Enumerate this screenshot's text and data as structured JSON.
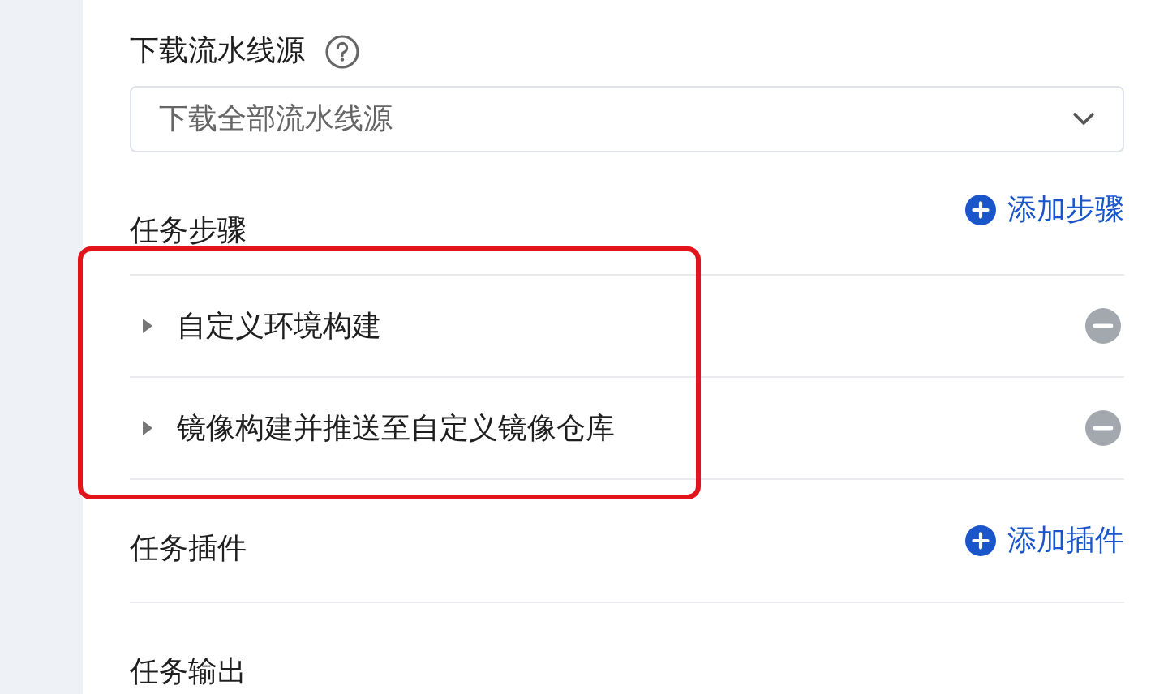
{
  "source_field": {
    "label": "下载流水线源",
    "value": "下载全部流水线源"
  },
  "steps_section": {
    "title": "任务步骤",
    "add_link": "添加步骤",
    "steps": [
      {
        "label": "自定义环境构建",
        "expanded": false
      },
      {
        "label": "镜像构建并推送至自定义镜像仓库",
        "expanded": false
      }
    ]
  },
  "plugins_section": {
    "title": "任务插件",
    "add_link": "添加插件"
  },
  "output_section": {
    "title": "任务输出"
  }
}
